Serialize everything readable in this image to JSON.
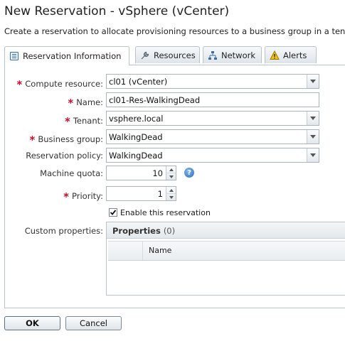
{
  "header": {
    "title": "New Reservation - vSphere (vCenter)",
    "subtitle": "Create a reservation to allocate provisioning resources to a business group in a tenant. Y"
  },
  "tabs": [
    {
      "label": "Reservation Information",
      "icon": "reservation-info-icon",
      "active": true
    },
    {
      "label": "Resources",
      "icon": "wrench-icon",
      "active": false
    },
    {
      "label": "Network",
      "icon": "network-icon",
      "active": false
    },
    {
      "label": "Alerts",
      "icon": "warning-icon",
      "active": false
    }
  ],
  "form": {
    "compute_resource": {
      "label": "Compute resource:",
      "value": "cl01 (vCenter)",
      "required": true
    },
    "name": {
      "label": "Name:",
      "value": "cl01-Res-WalkingDead",
      "required": true
    },
    "tenant": {
      "label": "Tenant:",
      "value": "vsphere.local",
      "required": true
    },
    "business_group": {
      "label": "Business group:",
      "value": "WalkingDead",
      "required": true
    },
    "reservation_policy": {
      "label": "Reservation policy:",
      "value": "WalkingDead",
      "required": false
    },
    "machine_quota": {
      "label": "Machine quota:",
      "value": "10",
      "required": false
    },
    "priority": {
      "label": "Priority:",
      "value": "1",
      "required": true
    },
    "enable": {
      "label": "Enable this reservation",
      "checked": true
    },
    "custom_properties": {
      "label": "Custom properties:",
      "grid_title": "Properties",
      "grid_count": "(0)",
      "columns": [
        "Name"
      ]
    },
    "required_marker": "*",
    "help_glyph": "?"
  },
  "buttons": {
    "ok": "OK",
    "cancel": "Cancel"
  },
  "colors": {
    "required": "#c8102e",
    "border": "#b8c3cc",
    "help": "#2f6fb8"
  }
}
